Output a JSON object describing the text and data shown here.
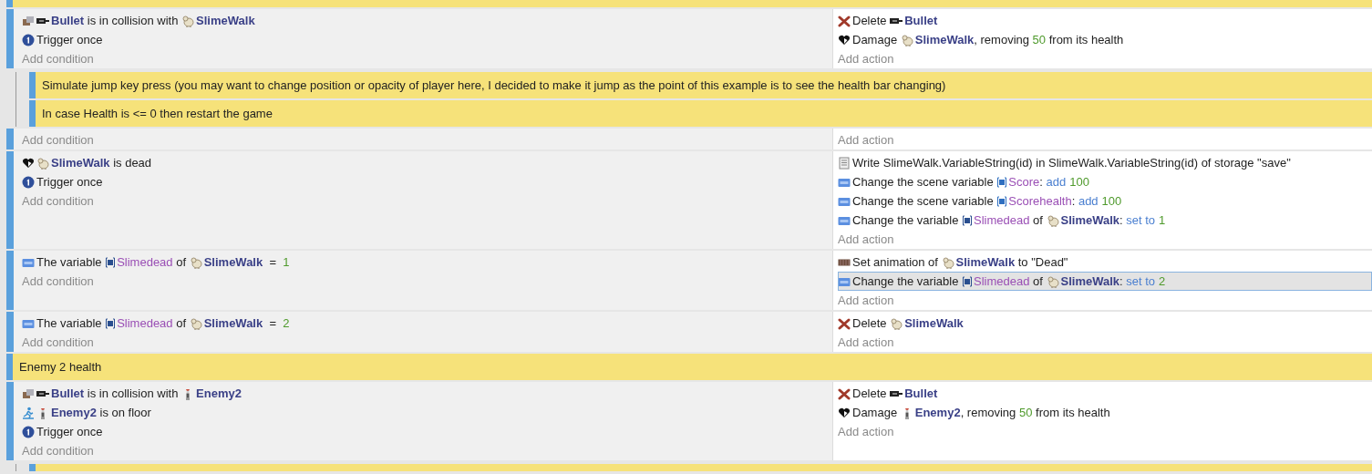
{
  "events": [
    {
      "kind": "comment"
    },
    {
      "kind": "standard",
      "add_condition": "Add condition",
      "add_action": "Add action",
      "conditions": [
        {
          "kind": "collision",
          "parts": [
            {
              "kind": "bullet_object",
              "text": "Bullet"
            },
            {
              "kind": "text",
              "text": " is in collision with "
            },
            {
              "kind": "slime_object",
              "text": "SlimeWalk"
            }
          ]
        },
        {
          "kind": "trigger",
          "parts": [
            {
              "kind": "text",
              "text": "Trigger once"
            }
          ]
        }
      ],
      "actions": [
        {
          "kind": "delete",
          "selected": false,
          "parts": [
            {
              "kind": "text",
              "text": "Delete "
            },
            {
              "kind": "bullet_object",
              "text": "Bullet"
            }
          ]
        },
        {
          "kind": "health",
          "selected": false,
          "parts": [
            {
              "kind": "text",
              "text": "Damage "
            },
            {
              "kind": "slime_object",
              "text": "SlimeWalk"
            },
            {
              "kind": "text",
              "text": ", removing "
            },
            {
              "kind": "number",
              "text": "50"
            },
            {
              "kind": "text",
              "text": " from its health"
            }
          ]
        }
      ],
      "children": [
        {
          "kind": "comment",
          "text": "Simulate jump key press (you may want to change position or opacity of player here, I decided to make it jump as the point of this example is to see the health bar changing)"
        },
        {
          "kind": "comment",
          "text": "In case Health is <= 0 then restart the game"
        }
      ]
    },
    {
      "kind": "standard",
      "add_condition": "Add condition",
      "add_action": "Add action"
    },
    {
      "kind": "standard",
      "add_condition": "Add condition",
      "add_action": "Add action",
      "conditions": [
        {
          "kind": "health",
          "parts": [
            {
              "kind": "slime_object",
              "text": "SlimeWalk"
            },
            {
              "kind": "text",
              "text": " is dead"
            }
          ]
        },
        {
          "kind": "trigger",
          "parts": [
            {
              "kind": "text",
              "text": "Trigger once"
            }
          ]
        }
      ],
      "actions": [
        {
          "kind": "storage",
          "selected": false,
          "parts": [
            {
              "kind": "text",
              "text": "Write SlimeWalk.VariableString(id) in SlimeWalk.VariableString(id) of storage \"save\""
            }
          ]
        },
        {
          "kind": "variable",
          "selected": false,
          "parts": [
            {
              "kind": "text",
              "text": "Change the scene variable "
            },
            {
              "kind": "scene_variable",
              "text": "Score"
            },
            {
              "kind": "text",
              "text": ": "
            },
            {
              "kind": "operator",
              "text": "add"
            },
            {
              "kind": "number",
              "text": "100"
            }
          ]
        },
        {
          "kind": "variable",
          "selected": false,
          "parts": [
            {
              "kind": "text",
              "text": "Change the scene variable "
            },
            {
              "kind": "scene_variable",
              "text": "Scorehealth"
            },
            {
              "kind": "text",
              "text": ": "
            },
            {
              "kind": "operator",
              "text": "add"
            },
            {
              "kind": "number",
              "text": "100"
            }
          ]
        },
        {
          "kind": "variable",
          "selected": false,
          "parts": [
            {
              "kind": "text",
              "text": "Change the variable "
            },
            {
              "kind": "object_variable",
              "text": "Slimedead"
            },
            {
              "kind": "text",
              "text": " of "
            },
            {
              "kind": "slime_object",
              "text": "SlimeWalk"
            },
            {
              "kind": "text",
              "text": ": "
            },
            {
              "kind": "operator",
              "text": "set to"
            },
            {
              "kind": "number",
              "text": "1"
            }
          ]
        }
      ]
    },
    {
      "kind": "standard",
      "add_condition": "Add condition",
      "add_action": "Add action",
      "conditions": [
        {
          "kind": "variable",
          "parts": [
            {
              "kind": "text",
              "text": "The variable "
            },
            {
              "kind": "object_variable",
              "text": "Slimedead"
            },
            {
              "kind": "text",
              "text": " of "
            },
            {
              "kind": "slime_object",
              "text": "SlimeWalk"
            },
            {
              "kind": "text",
              "text": "  =  "
            },
            {
              "kind": "number",
              "text": "1"
            }
          ]
        }
      ],
      "actions": [
        {
          "kind": "animation",
          "selected": false,
          "parts": [
            {
              "kind": "text",
              "text": "Set animation of "
            },
            {
              "kind": "slime_object",
              "text": "SlimeWalk"
            },
            {
              "kind": "text",
              "text": " to \"Dead\""
            }
          ]
        },
        {
          "kind": "variable",
          "selected": true,
          "parts": [
            {
              "kind": "text",
              "text": "Change the variable "
            },
            {
              "kind": "object_variable",
              "text": "Slimedead"
            },
            {
              "kind": "text",
              "text": " of "
            },
            {
              "kind": "slime_object",
              "text": "SlimeWalk"
            },
            {
              "kind": "text",
              "text": ": "
            },
            {
              "kind": "operator",
              "text": "set to"
            },
            {
              "kind": "number",
              "text": "2"
            }
          ]
        }
      ]
    },
    {
      "kind": "standard",
      "add_condition": "Add condition",
      "add_action": "Add action",
      "conditions": [
        {
          "kind": "variable",
          "parts": [
            {
              "kind": "text",
              "text": "The variable "
            },
            {
              "kind": "object_variable",
              "text": "Slimedead"
            },
            {
              "kind": "text",
              "text": " of "
            },
            {
              "kind": "slime_object",
              "text": "SlimeWalk"
            },
            {
              "kind": "text",
              "text": "  =  "
            },
            {
              "kind": "number",
              "text": "2"
            }
          ]
        }
      ],
      "actions": [
        {
          "kind": "delete",
          "selected": false,
          "parts": [
            {
              "kind": "text",
              "text": "Delete "
            },
            {
              "kind": "slime_object",
              "text": "SlimeWalk"
            }
          ]
        }
      ]
    },
    {
      "kind": "comment",
      "text": "Enemy 2 health"
    },
    {
      "kind": "standard",
      "add_condition": "Add condition",
      "add_action": "Add action",
      "conditions": [
        {
          "kind": "collision",
          "parts": [
            {
              "kind": "bullet_object",
              "text": "Bullet"
            },
            {
              "kind": "text",
              "text": " is in collision with "
            },
            {
              "kind": "enemy_object",
              "text": "Enemy2"
            }
          ]
        },
        {
          "kind": "platformer",
          "parts": [
            {
              "kind": "enemy_object",
              "text": "Enemy2"
            },
            {
              "kind": "text",
              "text": " is on floor"
            }
          ]
        },
        {
          "kind": "trigger",
          "parts": [
            {
              "kind": "text",
              "text": "Trigger once"
            }
          ]
        }
      ],
      "actions": [
        {
          "kind": "delete",
          "selected": false,
          "parts": [
            {
              "kind": "text",
              "text": "Delete "
            },
            {
              "kind": "bullet_object",
              "text": "Bullet"
            }
          ]
        },
        {
          "kind": "health",
          "selected": false,
          "parts": [
            {
              "kind": "text",
              "text": "Damage "
            },
            {
              "kind": "enemy_object",
              "text": "Enemy2"
            },
            {
              "kind": "text",
              "text": ", removing "
            },
            {
              "kind": "number",
              "text": "50"
            },
            {
              "kind": "text",
              "text": " from its health"
            }
          ]
        }
      ],
      "children": [
        {
          "kind": "comment"
        }
      ]
    }
  ]
}
